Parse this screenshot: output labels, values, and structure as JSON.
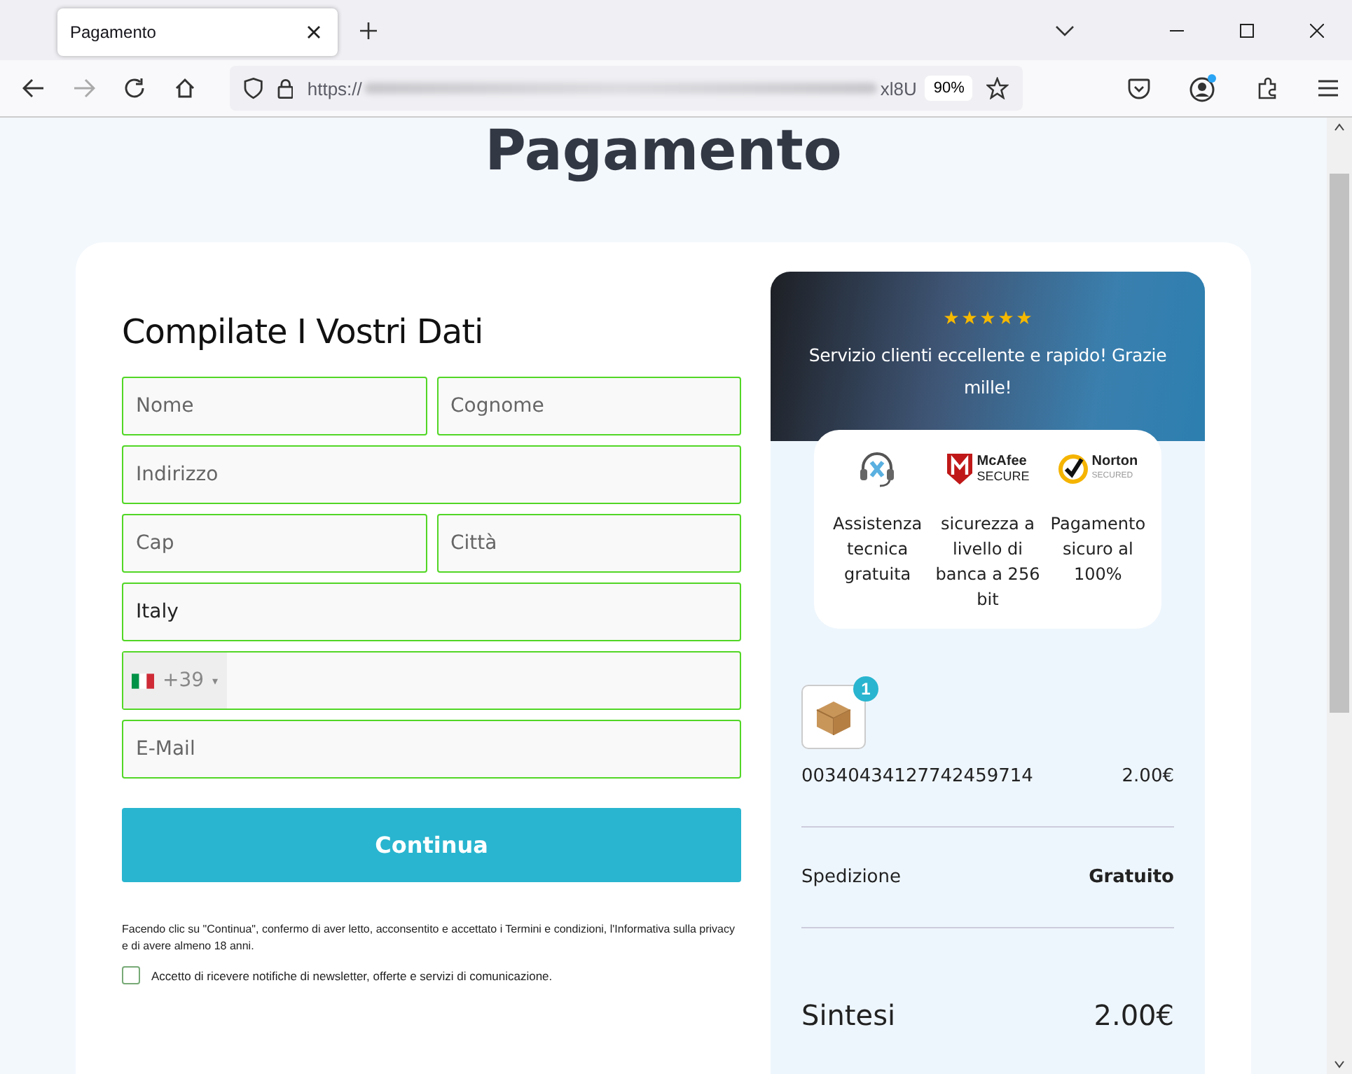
{
  "browser": {
    "tab_title": "Pagamento",
    "url_start": "https://",
    "url_end": "xl8U",
    "zoom": "90%"
  },
  "page_title": "Pagamento",
  "form": {
    "heading": "Compilate I Vostri Dati",
    "rows": [
      [
        {
          "kind": "text",
          "placeholder": "Nome"
        },
        {
          "kind": "text",
          "placeholder": "Cognome"
        }
      ],
      [
        {
          "kind": "text",
          "placeholder": "Indirizzo"
        }
      ],
      [
        {
          "kind": "text",
          "placeholder": "Cap"
        },
        {
          "kind": "text",
          "placeholder": "Città"
        }
      ],
      [
        {
          "kind": "text",
          "value": "Italy"
        }
      ],
      [
        {
          "kind": "phone",
          "dial_code": "+39",
          "caret": "▾"
        }
      ],
      [
        {
          "kind": "text",
          "placeholder": "E-Mail"
        }
      ]
    ],
    "submit": "Continua",
    "legal": "Facendo clic su \"Continua\", confermo di aver letto, acconsentito e accettato i Termini e condizioni, l'Informativa sulla privacy e di avere almeno 18 anni.",
    "newsletter": {
      "label": "Accetto di ricevere notifiche di newsletter, offerte e servizi di comunicazione.",
      "checked": false
    }
  },
  "summary": {
    "review": {
      "stars": 5,
      "text": "Servizio clienti eccellente e rapido! Grazie mille!"
    },
    "badges": [
      {
        "kind": "support",
        "text": "Assistenza tecnica gratuita"
      },
      {
        "kind": "mcafee",
        "logo_top": "McAfee",
        "logo_bottom": "SECURE",
        "text": "sicurezza a livello di banca a 256 bit"
      },
      {
        "kind": "norton",
        "logo_top": "Norton",
        "logo_bottom": "SECURED",
        "text": "Pagamento sicuro al 100%"
      }
    ],
    "item": {
      "quantity": "1",
      "name": "00340434127742459714",
      "price": "2.00€"
    },
    "shipping": {
      "label": "Spedizione",
      "value": "Gratuito"
    },
    "total": {
      "label": "Sintesi",
      "value": "2.00€"
    }
  }
}
